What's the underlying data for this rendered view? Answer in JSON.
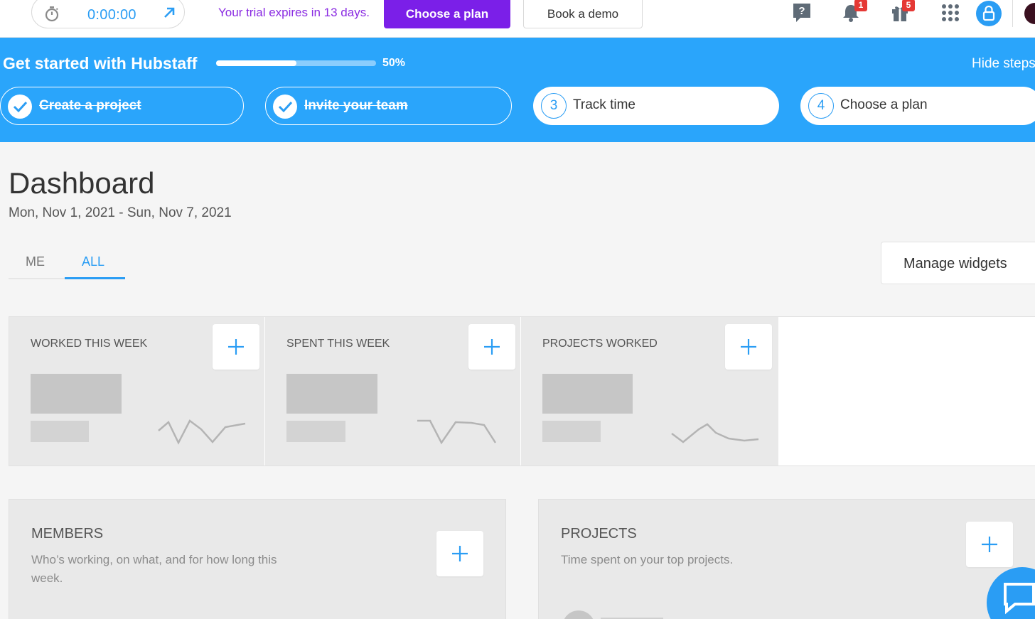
{
  "topbar": {
    "timer_value": "0:00:00",
    "trial_text": "Your trial expires in 13 days.",
    "choose_plan_label": "Choose a plan",
    "book_demo_label": "Book a demo",
    "notifications_count": "1",
    "gifts_count": "5",
    "icons": [
      "stopwatch-icon",
      "expand-arrow-icon",
      "help-icon",
      "bell-icon",
      "gift-icon",
      "apps-grid-icon",
      "user-avatar-icon"
    ]
  },
  "onboarding": {
    "title": "Get started with Hubstaff",
    "progress": 0.5,
    "progress_label": "50%",
    "hide_label": "Hide steps",
    "steps": [
      {
        "label": "Create a project",
        "done": true
      },
      {
        "label": "Invite your team",
        "done": true
      },
      {
        "number": "3",
        "label": "Track time",
        "done": false
      },
      {
        "number": "4",
        "label": "Choose a plan",
        "done": false
      }
    ]
  },
  "dashboard": {
    "title": "Dashboard",
    "date_range": "Mon, Nov 1, 2021 - Sun, Nov 7, 2021",
    "tabs": [
      {
        "label": "ME",
        "active": false
      },
      {
        "label": "ALL",
        "active": true
      }
    ],
    "manage_widgets_label": "Manage widgets"
  },
  "stat_widgets": [
    {
      "label": "WORKED THIS WEEK"
    },
    {
      "label": "SPENT THIS WEEK"
    },
    {
      "label": "PROJECTS WORKED"
    }
  ],
  "panels": [
    {
      "title": "MEMBERS",
      "description": "Who’s working, on what, and for how long this week."
    },
    {
      "title": "PROJECTS",
      "description": "Time spent on your top projects."
    }
  ],
  "colors": {
    "accent": "#2a9df4",
    "banner": "#2aa5fb",
    "plan_button": "#7b1fe8",
    "trial_text": "#8a2be2",
    "badge": "#e53935"
  }
}
